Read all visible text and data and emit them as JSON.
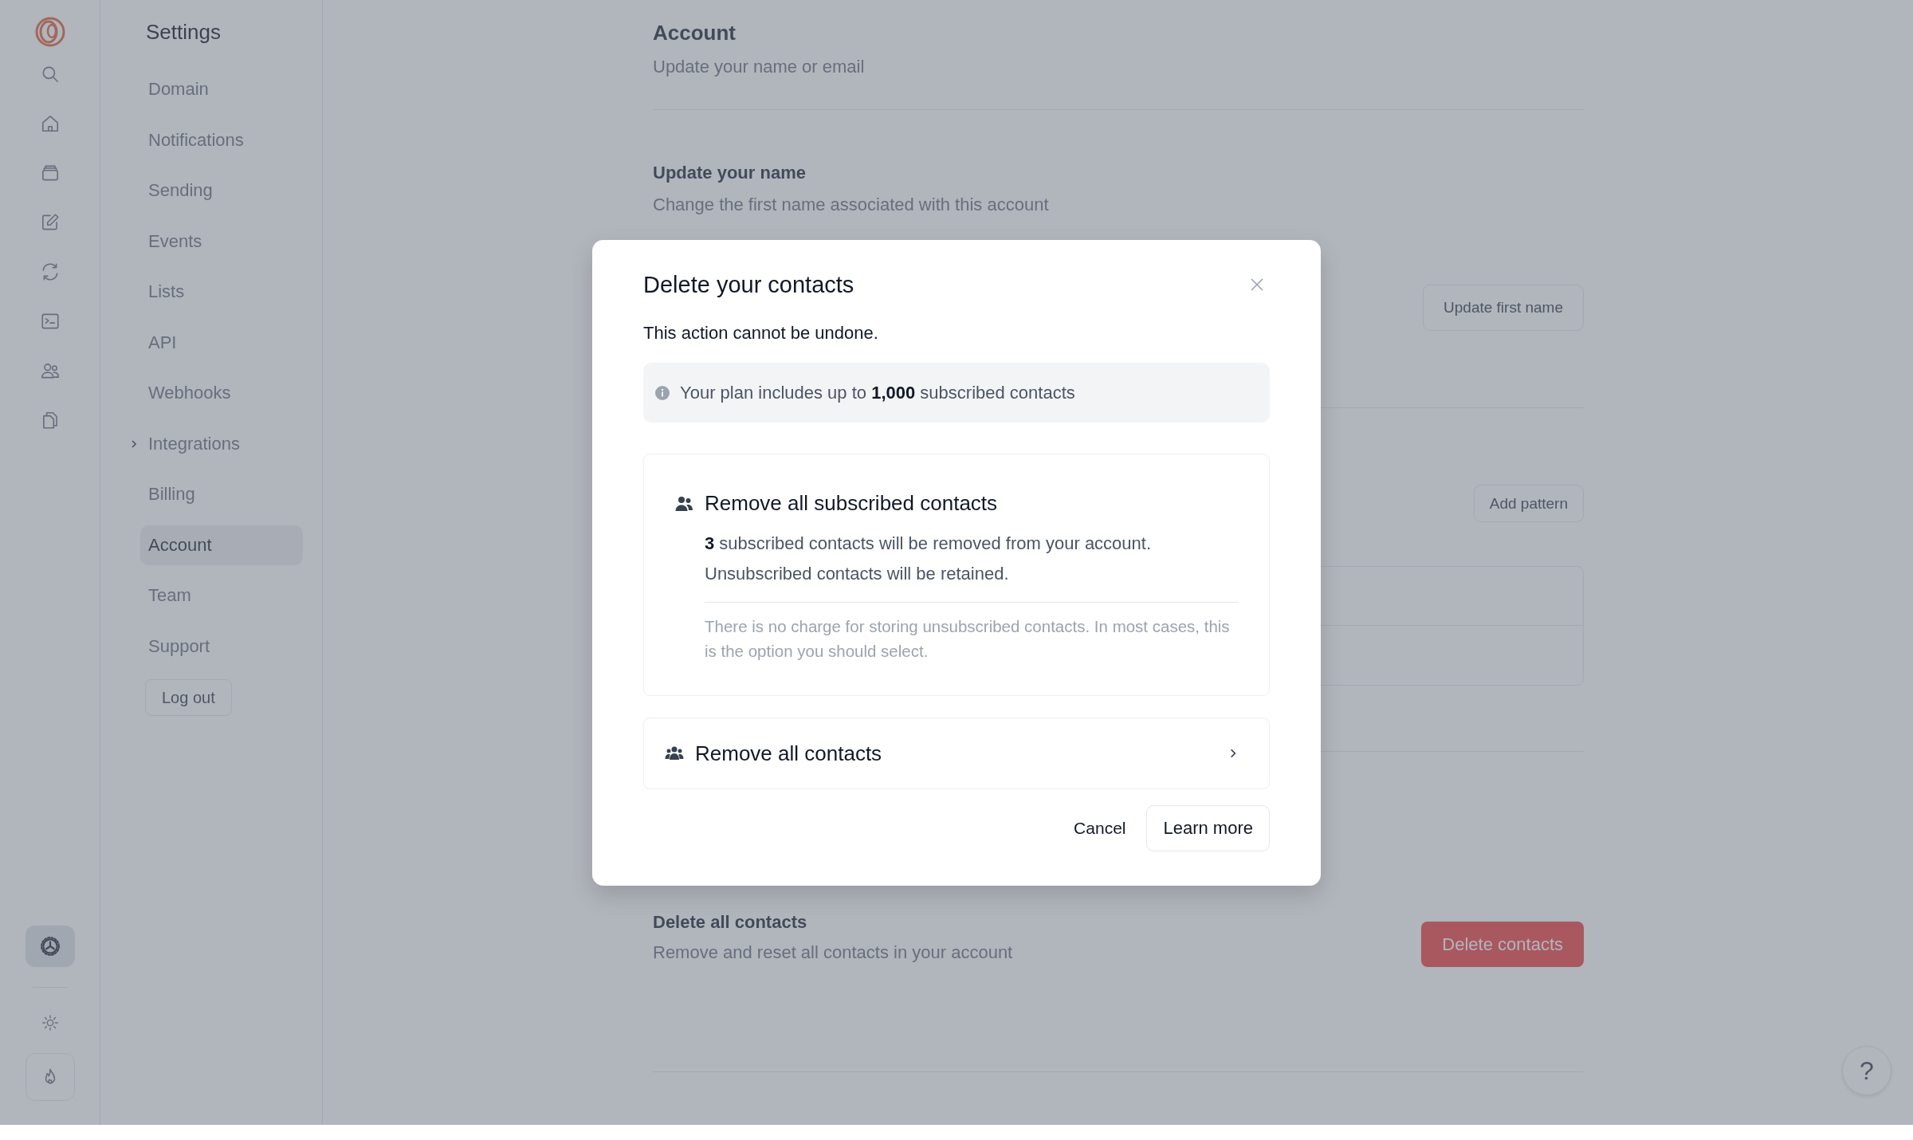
{
  "rail": {
    "top_items": [
      {
        "kind": "search",
        "selected": false
      },
      {
        "kind": "home",
        "selected": false
      },
      {
        "kind": "inbox",
        "selected": false
      },
      {
        "kind": "edit",
        "selected": false
      },
      {
        "kind": "sync",
        "selected": false
      },
      {
        "kind": "terminal",
        "selected": false
      },
      {
        "kind": "people",
        "selected": false
      },
      {
        "kind": "copy",
        "selected": false
      }
    ],
    "bottom_items": [
      {
        "kind": "settings",
        "selected": true
      },
      {
        "kind": "theme",
        "selected": false
      },
      {
        "kind": "flame",
        "selected": false
      }
    ]
  },
  "sidebar": {
    "title": "Settings",
    "items": [
      {
        "label": "Domain",
        "selected": false,
        "expandable": false
      },
      {
        "label": "Notifications",
        "selected": false,
        "expandable": false
      },
      {
        "label": "Sending",
        "selected": false,
        "expandable": false
      },
      {
        "label": "Events",
        "selected": false,
        "expandable": false
      },
      {
        "label": "Lists",
        "selected": false,
        "expandable": false
      },
      {
        "label": "API",
        "selected": false,
        "expandable": false
      },
      {
        "label": "Webhooks",
        "selected": false,
        "expandable": false
      },
      {
        "label": "Integrations",
        "selected": false,
        "expandable": true
      },
      {
        "label": "Billing",
        "selected": false,
        "expandable": false
      },
      {
        "label": "Account",
        "selected": true,
        "expandable": false
      },
      {
        "label": "Team",
        "selected": false,
        "expandable": false
      },
      {
        "label": "Support",
        "selected": false,
        "expandable": false
      }
    ],
    "logout": "Log out"
  },
  "content": {
    "title": "Account",
    "subtitle": "Update your name or email",
    "name_section": {
      "title": "Update your name",
      "subtitle": "Change the first name associated with this account",
      "button": "Update first name"
    },
    "pattern_section": {
      "button": "Add pattern"
    },
    "delete_section": {
      "title": "Delete all contacts",
      "subtitle": "Remove and reset all contacts in your account",
      "button": "Delete contacts"
    }
  },
  "modal": {
    "title": "Delete your contacts",
    "warning": "This action cannot be undone.",
    "info": "Your plan includes up to **1,000** subscribed contacts",
    "options": [
      {
        "kind": "subscribed",
        "title": "Remove all subscribed contacts",
        "expanded": true,
        "body_lines": [
          "**3** subscribed contacts will be removed from your account.",
          "Unsubscribed contacts will be retained."
        ],
        "note": "There is no charge for storing unsubscribed contacts. In most cases, this is the option you should select."
      },
      {
        "kind": "all",
        "title": "Remove all contacts",
        "expanded": false
      }
    ],
    "cancel": "Cancel",
    "confirm": "Learn more"
  },
  "help": "?"
}
